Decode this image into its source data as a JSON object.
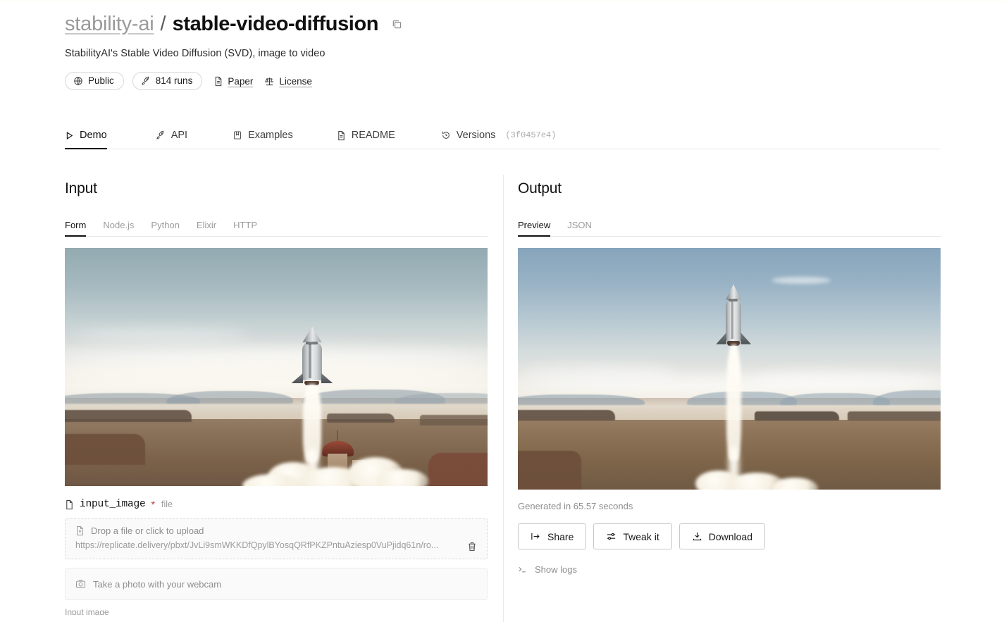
{
  "header": {
    "owner": "stability-ai",
    "separator": "/",
    "model_name": "stable-video-diffusion",
    "copy_icon": "copy-icon",
    "description": "StabilityAI's Stable Video Diffusion (SVD), image to video",
    "badges": [
      {
        "label": "Public",
        "icon": "globe-icon"
      },
      {
        "label": "814 runs",
        "icon": "rocket-icon"
      }
    ],
    "links": [
      {
        "label": "Paper",
        "icon": "document-icon"
      },
      {
        "label": "License",
        "icon": "scales-icon"
      }
    ]
  },
  "tabs": [
    {
      "label": "Demo",
      "icon": "play-icon",
      "active": true
    },
    {
      "label": "API",
      "icon": "rocket-icon",
      "active": false
    },
    {
      "label": "Examples",
      "icon": "book-icon",
      "active": false
    },
    {
      "label": "README",
      "icon": "document-icon",
      "active": false
    },
    {
      "label": "Versions",
      "icon": "history-icon",
      "active": false,
      "hash": "(3f0457e4)"
    }
  ],
  "input": {
    "title": "Input",
    "subtabs": [
      {
        "label": "Form",
        "active": true
      },
      {
        "label": "Node.js",
        "active": false
      },
      {
        "label": "Python",
        "active": false
      },
      {
        "label": "Elixir",
        "active": false
      },
      {
        "label": "HTTP",
        "active": false
      }
    ],
    "preview_alt": "rocket launching over desert",
    "field": {
      "icon": "file-icon",
      "name": "input_image",
      "required_marker": "*",
      "type": "file"
    },
    "dropzone": {
      "icon": "upload-file-icon",
      "placeholder": "Drop a file or click to upload",
      "value": "https://replicate.delivery/pbxt/JvLi9smWKKDfQpylBYosqQRfPKZPntuAziesp0VuPjidq61n/ro...",
      "delete_icon": "trash-icon"
    },
    "webcam": {
      "icon": "camera-icon",
      "label": "Take a photo with your webcam"
    },
    "helper_cut": "Input image"
  },
  "output": {
    "title": "Output",
    "subtabs": [
      {
        "label": "Preview",
        "active": true
      },
      {
        "label": "JSON",
        "active": false
      }
    ],
    "preview_alt": "generated rocket launch video frame",
    "generated_text": "Generated in 65.57 seconds",
    "buttons": [
      {
        "label": "Share",
        "icon": "share-icon"
      },
      {
        "label": "Tweak it",
        "icon": "sliders-icon"
      },
      {
        "label": "Download",
        "icon": "download-icon"
      }
    ],
    "show_logs": {
      "label": "Show logs",
      "icon": "terminal-icon"
    }
  },
  "colors": {
    "accent": "#111111",
    "muted": "#9b9b9b",
    "border": "#e6e6e6",
    "required": "#c0392b",
    "panel_bg": "#fafafa"
  }
}
